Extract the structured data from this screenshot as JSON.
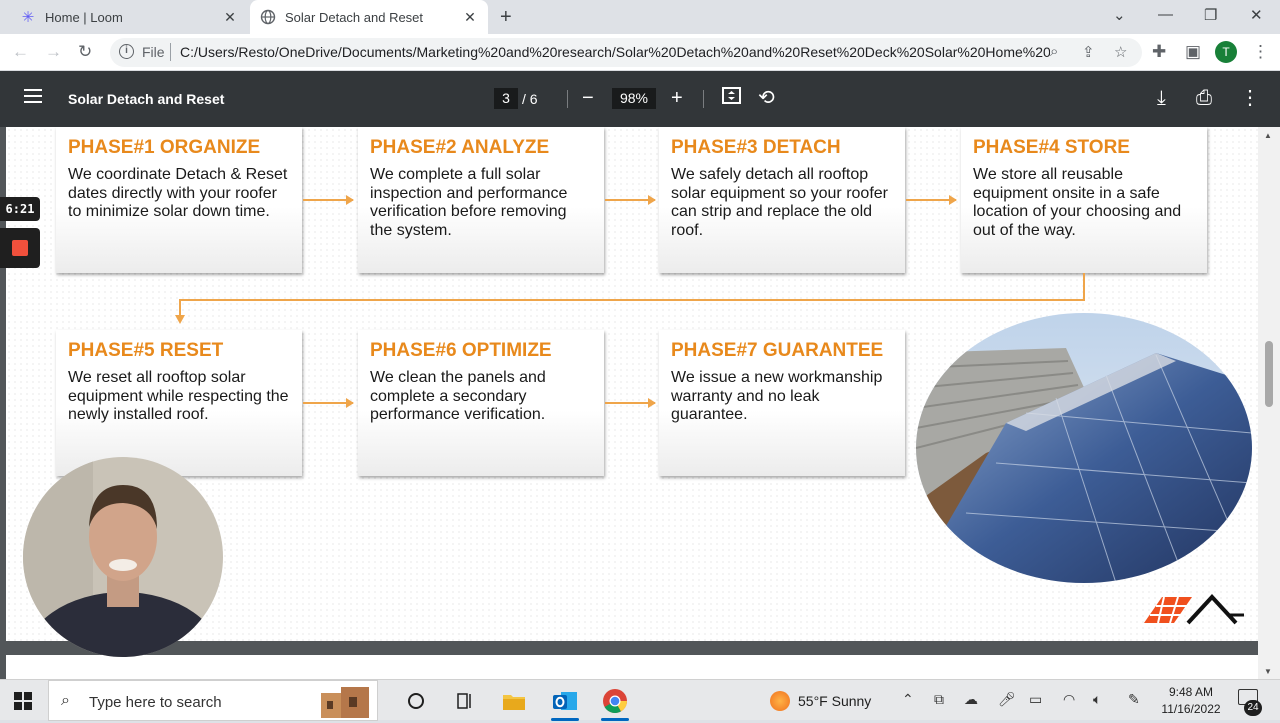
{
  "browser": {
    "tabs": [
      {
        "title": "Home | Loom",
        "active": false
      },
      {
        "title": "Solar Detach and Reset",
        "active": true
      }
    ],
    "file_label": "File",
    "url": "C:/Users/Resto/OneDrive/Documents/Marketing%20and%20research/Solar%20Detach%20and%20Reset%20Deck%20Solar%20Home%20...",
    "profile_initial": "T"
  },
  "pdf_toolbar": {
    "title": "Solar Detach and Reset",
    "current_page": "3",
    "total_pages": "/  6",
    "zoom": "98%"
  },
  "slide": {
    "phases": [
      {
        "title": "PHASE#1 ORGANIZE",
        "text": "We coordinate Detach & Reset dates directly with your roofer to minimize solar down time."
      },
      {
        "title": "PHASE#2 ANALYZE",
        "text": "We complete a full solar inspection and performance verification before removing the system."
      },
      {
        "title": "PHASE#3 DETACH",
        "text": "We safely detach all rooftop solar equipment so your roofer can strip and replace the old roof."
      },
      {
        "title": "PHASE#4 STORE",
        "text": "We store all reusable equipment onsite in a safe location of your choosing and out of the way."
      },
      {
        "title": "PHASE#5 RESET",
        "text": "We reset all rooftop solar equipment while respecting the newly installed roof."
      },
      {
        "title": "PHASE#6 OPTIMIZE",
        "text": "We clean the panels and complete a secondary performance verification."
      },
      {
        "title": "PHASE#7 GUARANTEE",
        "text": "We issue a new workmanship warranty and no leak guarantee."
      }
    ],
    "accent_color": "#e8891c"
  },
  "loom": {
    "timer": "6:21"
  },
  "taskbar": {
    "search_placeholder": "Type here to search",
    "weather": "55°F  Sunny",
    "time": "9:48 AM",
    "date": "11/16/2022",
    "notifications": "24"
  }
}
